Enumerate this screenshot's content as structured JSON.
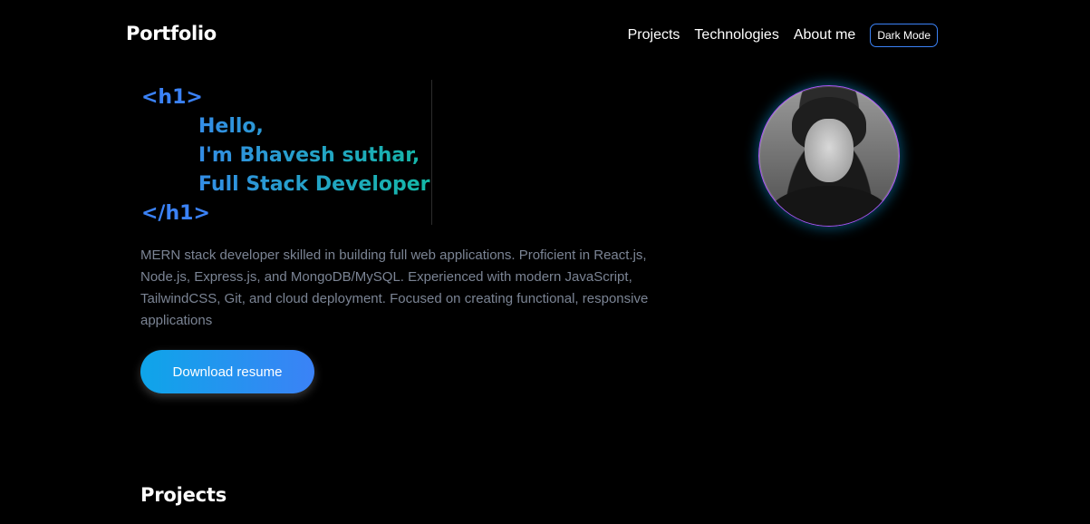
{
  "header": {
    "brand": "Portfolio",
    "nav": [
      "Projects",
      "Technologies",
      "About me"
    ],
    "mode_toggle": "Dark Mode"
  },
  "hero": {
    "open_tag": "<h1>",
    "lines": [
      "Hello,",
      "I'm Bhavesh suthar,",
      "Full Stack Developer"
    ],
    "close_tag": "</h1>",
    "description": "MERN stack developer skilled in building full web applications. Proficient in React.js, Node.js, Express.js, and MongoDB/MySQL. Experienced with modern JavaScript, TailwindCSS, Git, and cloud deployment. Focused on creating functional, responsive applications",
    "cta_label": "Download resume"
  },
  "sections": {
    "projects_title": "Projects"
  },
  "colors": {
    "background": "#000000",
    "accent_blue": "#3b82f6",
    "accent_teal": "#14b8a6",
    "button_start": "#0ea5e9",
    "muted_text": "#7b8494"
  }
}
